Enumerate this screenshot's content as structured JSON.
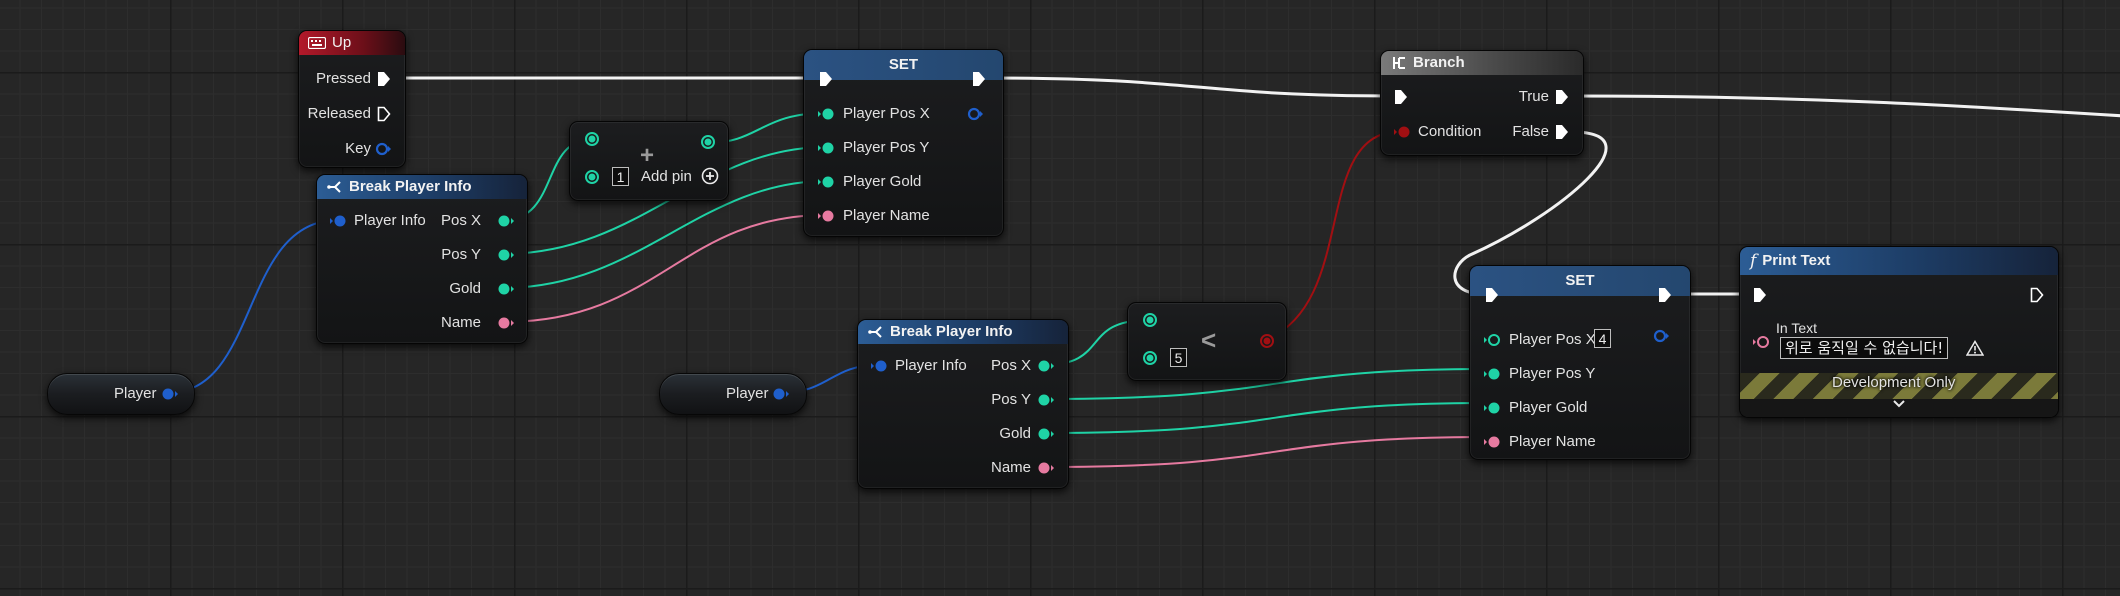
{
  "nodes": {
    "up_event": {
      "title": "Up",
      "pins": {
        "pressed": "Pressed",
        "released": "Released",
        "key": "Key"
      }
    },
    "break_player_info_1": {
      "title": "Break Player Info",
      "input": "Player Info",
      "outputs": {
        "pos_x": "Pos X",
        "pos_y": "Pos Y",
        "gold": "Gold",
        "name": "Name"
      }
    },
    "player_var_1": {
      "label": "Player"
    },
    "add_node": {
      "value": "1",
      "add_pin_label": "Add pin",
      "plus_glyph": "+"
    },
    "set_1": {
      "title": "SET",
      "inputs": {
        "pos_x": "Player Pos X",
        "pos_y": "Player Pos Y",
        "gold": "Player Gold",
        "name": "Player Name"
      }
    },
    "branch": {
      "title": "Branch",
      "condition": "Condition",
      "true_label": "True",
      "false_label": "False"
    },
    "player_var_2": {
      "label": "Player"
    },
    "break_player_info_2": {
      "title": "Break Player Info",
      "input": "Player Info",
      "outputs": {
        "pos_x": "Pos X",
        "pos_y": "Pos Y",
        "gold": "Gold",
        "name": "Name"
      }
    },
    "less_node": {
      "value": "5",
      "operator": "<"
    },
    "set_2": {
      "title": "SET",
      "pos_x_value": "4",
      "inputs": {
        "pos_x": "Player Pos X",
        "pos_y": "Player Pos Y",
        "gold": "Player Gold",
        "name": "Player Name"
      }
    },
    "print_text": {
      "title": "Print Text",
      "in_text_label": "In Text",
      "in_text_value": "위로 움직일 수 없습니다!",
      "dev_only": "Development Only"
    }
  },
  "colors": {
    "exec": "#ffffff",
    "struct": "#1f5fcc",
    "integer": "#1fd3a6",
    "string": "#e67aa0",
    "boolean": "#a10f12",
    "graph_bg": "#262626"
  },
  "icons": [
    "keyboard-icon",
    "break-struct-icon",
    "branch-icon",
    "function-icon",
    "warning-icon",
    "add-pin-icon",
    "chevron-down-icon"
  ]
}
